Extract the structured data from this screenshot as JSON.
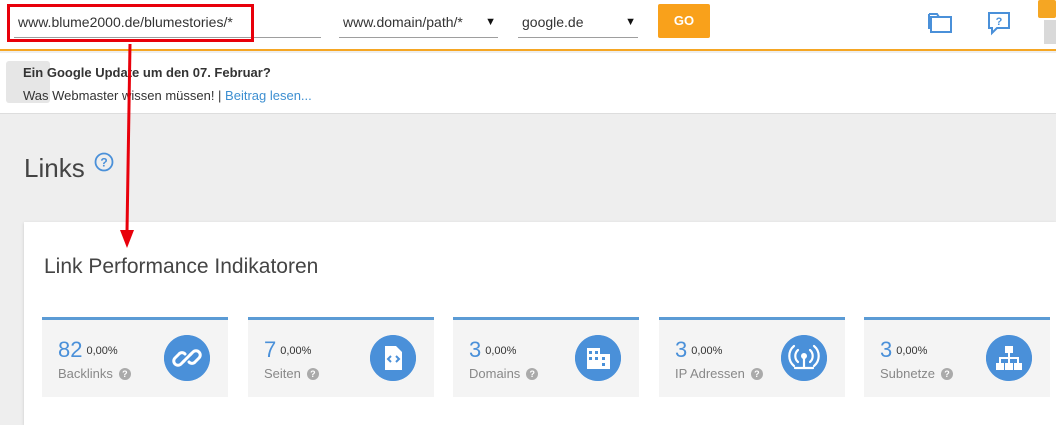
{
  "topbar": {
    "url_value": "www.blume2000.de/blumestories/*",
    "mode_value": "www.domain/path/*",
    "engine_value": "google.de",
    "go_label": "GO"
  },
  "notice": {
    "title": "Ein Google Update um den 07. Februar?",
    "text": "Was Webmaster wissen müssen! | ",
    "link": "Beitrag lesen..."
  },
  "page": {
    "title": "Links"
  },
  "card": {
    "title": "Link Performance Indikatoren",
    "kpis": [
      {
        "value": "82",
        "pct": "0,00%",
        "label": "Backlinks",
        "icon": "link-icon"
      },
      {
        "value": "7",
        "pct": "0,00%",
        "label": "Seiten",
        "icon": "code-file-icon"
      },
      {
        "value": "3",
        "pct": "0,00%",
        "label": "Domains",
        "icon": "building-icon"
      },
      {
        "value": "3",
        "pct": "0,00%",
        "label": "IP Adressen",
        "icon": "broadcast-icon"
      },
      {
        "value": "3",
        "pct": "0,00%",
        "label": "Subnetze",
        "icon": "sitemap-icon"
      }
    ]
  },
  "colors": {
    "accent": "#f5a623",
    "go_button": "#f9a11b",
    "kpi_blue": "#4a90d9",
    "highlight": "#e8000b"
  }
}
